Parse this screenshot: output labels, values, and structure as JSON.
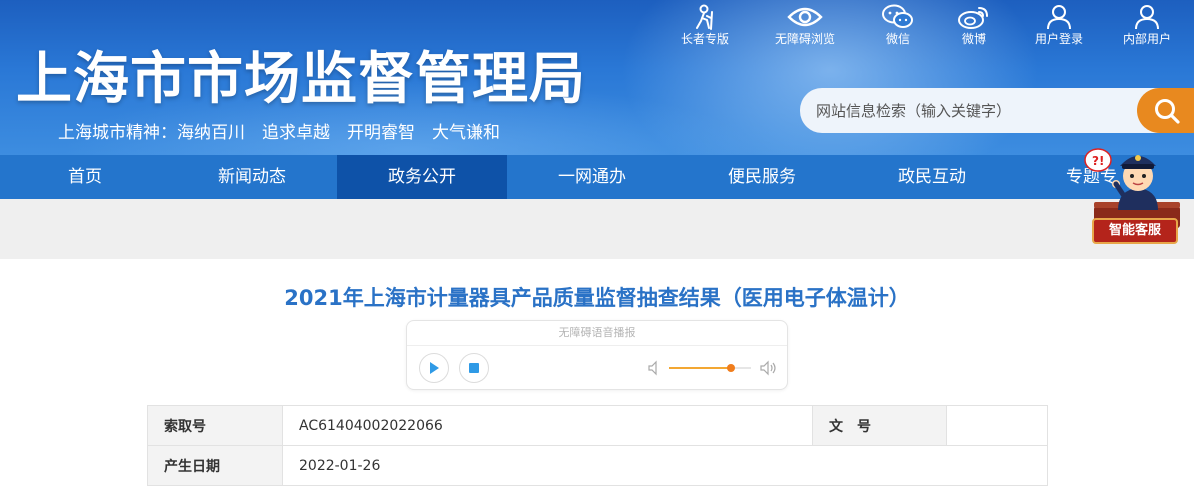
{
  "header": {
    "site_title": "上海市市场监督管理局",
    "slogan": "上海城市精神：海纳百川　追求卓越　开明睿智　大气谦和",
    "top_links": [
      {
        "label": "长者专版",
        "icon": "elder-icon"
      },
      {
        "label": "无障碍浏览",
        "icon": "eye-icon"
      },
      {
        "label": "微信",
        "icon": "wechat-icon"
      },
      {
        "label": "微博",
        "icon": "weibo-icon"
      },
      {
        "label": "用户登录",
        "icon": "user-icon"
      },
      {
        "label": "内部用户",
        "icon": "internal-user-icon"
      }
    ],
    "search": {
      "placeholder": "网站信息检索（输入关键字）",
      "icon": "search-icon"
    }
  },
  "nav": {
    "items": [
      {
        "label": "首页"
      },
      {
        "label": "新闻动态"
      },
      {
        "label": "政务公开",
        "active": true
      },
      {
        "label": "一网通办"
      },
      {
        "label": "便民服务"
      },
      {
        "label": "政民互动"
      },
      {
        "label": "专题专"
      }
    ]
  },
  "assistant": {
    "label": "智能客服"
  },
  "article": {
    "title": "2021年上海市计量器具产品质量监督抽查结果（医用电子体温计）",
    "player": {
      "label": "无障碍语音播报",
      "volume": 0.75
    },
    "info": {
      "index_label": "索取号",
      "index_value": "AC61404002022066",
      "doc_no_label": "文　号",
      "doc_no_value": "",
      "date_label": "产生日期",
      "date_value": "2022-01-26"
    }
  },
  "colors": {
    "header_blue": "#2a78d6",
    "nav_blue": "#2475cc",
    "nav_active": "#0e52a8",
    "search_button": "#e8891f",
    "title_blue": "#2a72c6",
    "play_icon": "#2f9ae6",
    "volume": "#f07d1c"
  }
}
